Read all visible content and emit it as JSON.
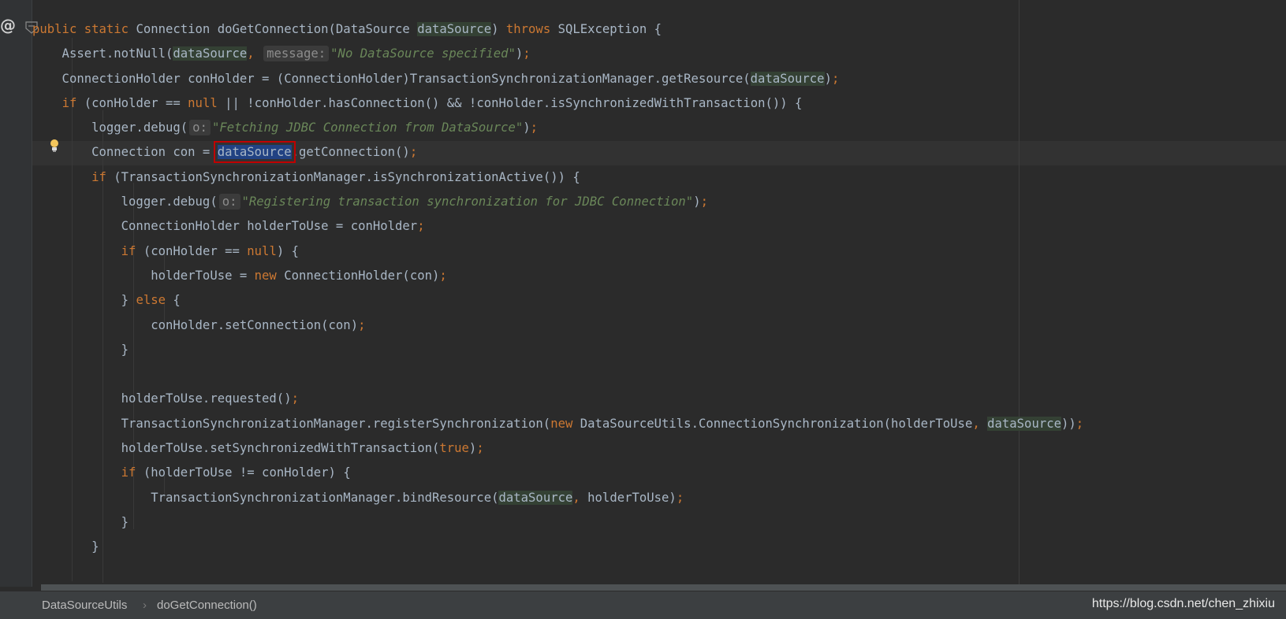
{
  "editor": {
    "lines": [
      [
        {
          "t": "public static ",
          "c": "kw"
        },
        {
          "t": "Connection doGetConnection(DataSource "
        },
        {
          "t": "dataSource",
          "c": "hl"
        },
        {
          "t": ") "
        },
        {
          "t": "throws ",
          "c": "kw"
        },
        {
          "t": "SQLException {"
        }
      ],
      [
        {
          "t": "    Assert."
        },
        {
          "t": "notNull"
        },
        {
          "t": "("
        },
        {
          "t": "dataSource",
          "c": "hl"
        },
        {
          "t": ",",
          "c": "kw"
        },
        {
          "t": " "
        },
        {
          "t": "message:",
          "c": "hint"
        },
        {
          "t": "\"No DataSource specified\"",
          "c": "str"
        },
        {
          "t": ")"
        },
        {
          "t": ";",
          "c": "kw"
        }
      ],
      [
        {
          "t": "    ConnectionHolder conHolder = (ConnectionHolder)TransactionSynchronizationManager."
        },
        {
          "t": "getResource"
        },
        {
          "t": "("
        },
        {
          "t": "dataSource",
          "c": "hl"
        },
        {
          "t": ")"
        },
        {
          "t": ";",
          "c": "kw"
        }
      ],
      [
        {
          "t": "    "
        },
        {
          "t": "if ",
          "c": "kw"
        },
        {
          "t": "(conHolder == "
        },
        {
          "t": "null ",
          "c": "kw"
        },
        {
          "t": "|| !conHolder.hasConnection() && !conHolder.isSynchronizedWithTransaction()) {"
        }
      ],
      [
        {
          "t": "        logger.debug("
        },
        {
          "t": "o:",
          "c": "hint"
        },
        {
          "t": "\"Fetching JDBC Connection from DataSource\"",
          "c": "str"
        },
        {
          "t": ")"
        },
        {
          "t": ";",
          "c": "kw"
        }
      ],
      [
        {
          "t": "        Connection con = "
        },
        {
          "t": "dataSource",
          "c": "sel"
        },
        {
          "t": ".getConnection()"
        },
        {
          "t": ";",
          "c": "kw"
        }
      ],
      [
        {
          "t": "        "
        },
        {
          "t": "if ",
          "c": "kw"
        },
        {
          "t": "(TransactionSynchronizationManager."
        },
        {
          "t": "isSynchronizationActive"
        },
        {
          "t": "()) {"
        }
      ],
      [
        {
          "t": "            logger.debug("
        },
        {
          "t": "o:",
          "c": "hint"
        },
        {
          "t": "\"Registering transaction synchronization for JDBC Connection\"",
          "c": "str"
        },
        {
          "t": ")"
        },
        {
          "t": ";",
          "c": "kw"
        }
      ],
      [
        {
          "t": "            ConnectionHolder holderToUse = conHolder"
        },
        {
          "t": ";",
          "c": "kw"
        }
      ],
      [
        {
          "t": "            "
        },
        {
          "t": "if ",
          "c": "kw"
        },
        {
          "t": "(conHolder == "
        },
        {
          "t": "null",
          "c": "kw"
        },
        {
          "t": ") {"
        }
      ],
      [
        {
          "t": "                holderToUse = "
        },
        {
          "t": "new ",
          "c": "kw"
        },
        {
          "t": "ConnectionHolder(con)"
        },
        {
          "t": ";",
          "c": "kw"
        }
      ],
      [
        {
          "t": "            } "
        },
        {
          "t": "else ",
          "c": "kw"
        },
        {
          "t": "{"
        }
      ],
      [
        {
          "t": "                conHolder.setConnection(con)"
        },
        {
          "t": ";",
          "c": "kw"
        }
      ],
      [
        {
          "t": "            }"
        }
      ],
      [
        {
          "t": ""
        }
      ],
      [
        {
          "t": "            holderToUse.requested()"
        },
        {
          "t": ";",
          "c": "kw"
        }
      ],
      [
        {
          "t": "            TransactionSynchronizationManager."
        },
        {
          "t": "registerSynchronization"
        },
        {
          "t": "("
        },
        {
          "t": "new ",
          "c": "kw"
        },
        {
          "t": "DataSourceUtils.ConnectionSynchronization(holderToUse"
        },
        {
          "t": ", ",
          "c": "kw"
        },
        {
          "t": "dataSource",
          "c": "hl"
        },
        {
          "t": "))"
        },
        {
          "t": ";",
          "c": "kw"
        }
      ],
      [
        {
          "t": "            holderToUse.setSynchronizedWithTransaction("
        },
        {
          "t": "true",
          "c": "kw"
        },
        {
          "t": ")"
        },
        {
          "t": ";",
          "c": "kw"
        }
      ],
      [
        {
          "t": "            "
        },
        {
          "t": "if ",
          "c": "kw"
        },
        {
          "t": "(holderToUse != conHolder) {"
        }
      ],
      [
        {
          "t": "                TransactionSynchronizationManager."
        },
        {
          "t": "bindResource"
        },
        {
          "t": "("
        },
        {
          "t": "dataSource",
          "c": "hl"
        },
        {
          "t": ", ",
          "c": "kw"
        },
        {
          "t": "holderToUse)"
        },
        {
          "t": ";",
          "c": "kw"
        }
      ],
      [
        {
          "t": "            }"
        }
      ],
      [
        {
          "t": "        }"
        }
      ]
    ]
  },
  "statusbar": {
    "breadcrumb": [
      "DataSourceUtils",
      "doGetConnection()"
    ],
    "separator": "›",
    "watermark": "https://blog.csdn.net/chen_zhixiu"
  },
  "gutter": {
    "override_icon": "@"
  },
  "icons": [
    "at-override-icon",
    "fold-icon",
    "lightbulb-icon"
  ],
  "colors": {
    "background": "#2b2b2b",
    "keyword": "#cc7832",
    "string": "#6a8759",
    "text": "#a9b7c6",
    "selection": "#214283",
    "annotation_box": "#c00000"
  }
}
